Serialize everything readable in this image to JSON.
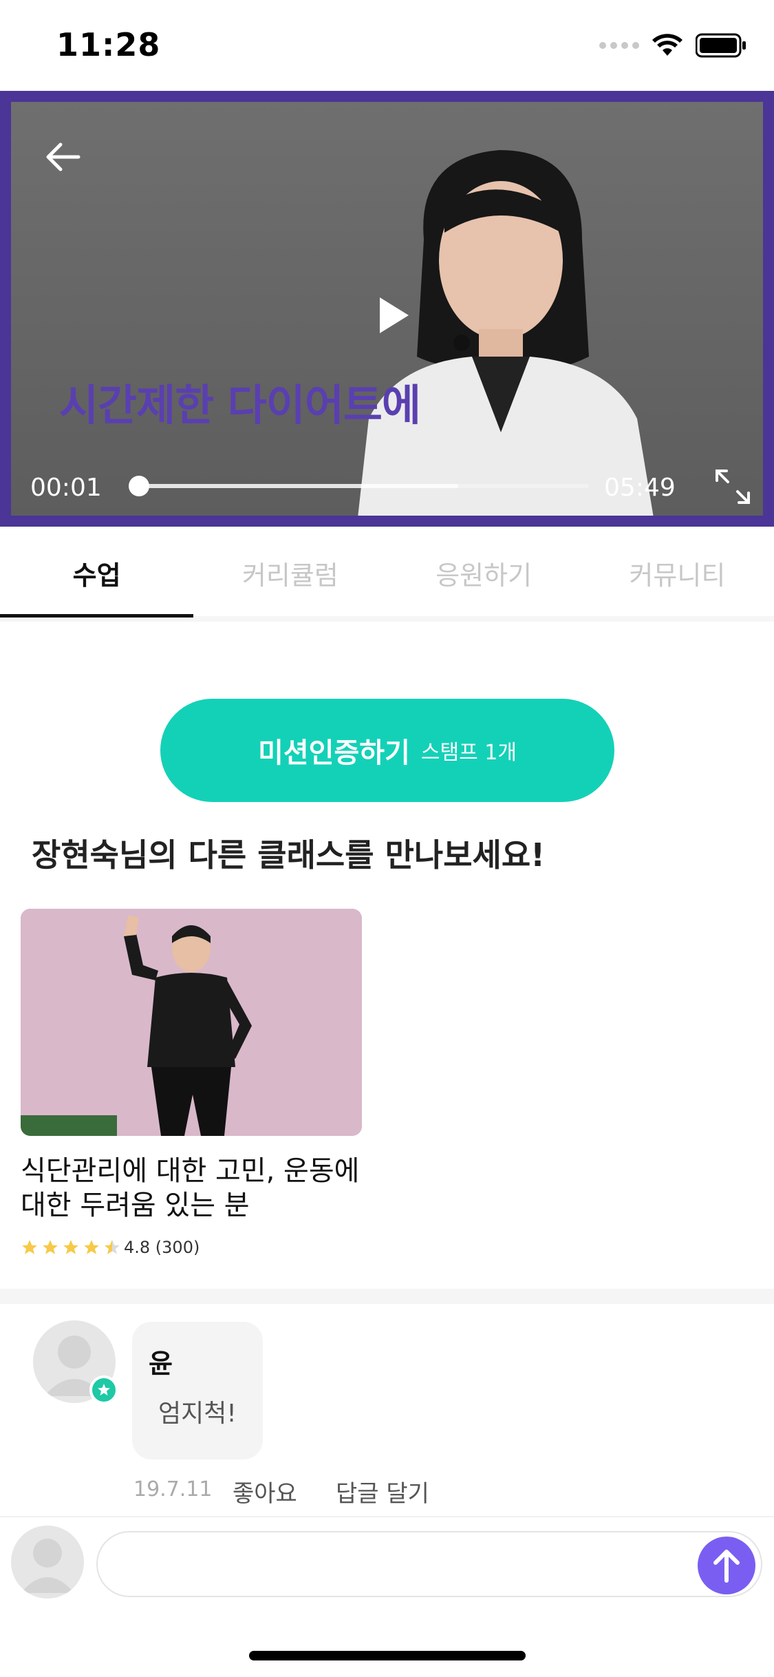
{
  "status_bar": {
    "time": "11:28"
  },
  "video": {
    "overlay_text": "시간제한 다이어트에",
    "current_time": "00:01",
    "total_time": "05:49",
    "progress_fraction": 0.003,
    "buffered_fraction": 0.71
  },
  "tabs": [
    {
      "label": "수업",
      "active": true
    },
    {
      "label": "커리큘럼",
      "active": false
    },
    {
      "label": "응원하기",
      "active": false
    },
    {
      "label": "커뮤니티",
      "active": false
    }
  ],
  "mission": {
    "label": "미션인증하기",
    "sub_label": "스탬프 1개"
  },
  "section": {
    "title": "장현숙님의 다른 클래스를 만나보세요!"
  },
  "class_card": {
    "title": "식단관리에 대한 고민, 운동에 대한 두려움 있는 분",
    "rating_text": "4.8 (300)",
    "stars": 4.5
  },
  "comment": {
    "author": "윤",
    "text": "엄지척!",
    "date": "19.7.11",
    "like_label": "좋아요",
    "reply_label": "답글 달기"
  },
  "input": {
    "placeholder": ""
  },
  "colors": {
    "accent": "#13d1b7",
    "video_border": "#4b3596",
    "send": "#7a5ef2",
    "star": "#f7c948"
  }
}
